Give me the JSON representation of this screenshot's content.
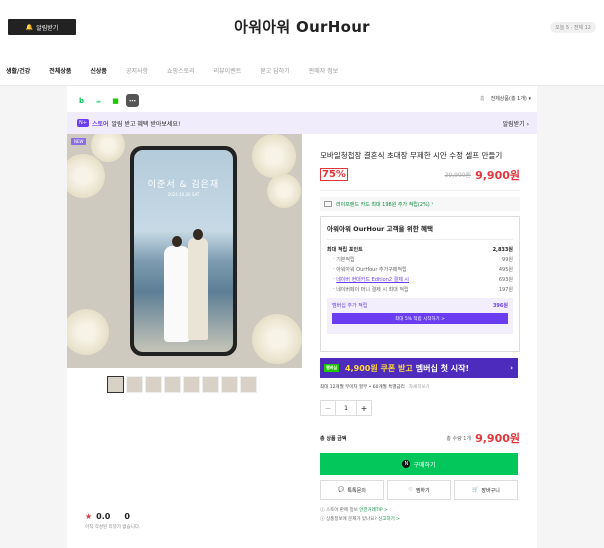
{
  "header": {
    "alarm_button": "알림받기",
    "store_name": "아워아워 OurHour",
    "visits": "오늘 5 · 전체 12"
  },
  "nav": [
    "생활/건강",
    "전체상품",
    "신상품",
    "공지사항",
    "쇼핑스토리",
    "리뷰이벤트",
    "묻고 답하기",
    "판매자 정보"
  ],
  "breadcrumb": {
    "home": "홈",
    "current": "전체상품(총 1개)"
  },
  "banner": {
    "badge": "N+",
    "brand": "스토어",
    "text": "알림 받고 혜택 받아보세요!",
    "button": "알림받기"
  },
  "product": {
    "new_badge": "NEW",
    "screen_names": "이준서 & 김은재",
    "screen_date": "2024.10.26 SAT",
    "name": "모바일청첩장 결혼식 초대장 무제한 시안 수정 셀프 만들기",
    "discount": "75%",
    "original_price": "39,900원",
    "price": "9,900원",
    "card_benefit": "라이프랜드 카드 최대 198원 추가 적립(2%)",
    "benefits": {
      "title": "아워아워 OurHour 고객을 위한 혜택",
      "max_label": "최대 적립 포인트",
      "max_value": "2,833원",
      "rows": [
        {
          "label": "기본적립",
          "value": "99원"
        },
        {
          "label": "아워아워 OurHour 추가구매적립",
          "value": "495원"
        },
        {
          "label": "네이버 현대카드 Edition2 결제 시",
          "value": "693원"
        },
        {
          "label": "네이버페이 머니 결제 시 최대 적립",
          "value": "197원"
        }
      ],
      "membership_label": "멤버십 추가 적립",
      "membership_value": "396원",
      "membership_button": "최대 5% 적립 시작하기 >"
    },
    "coupon": {
      "badge": "멤버십",
      "highlight": "4,900원 쿠폰 받고",
      "text": "멤버십 첫 시작!"
    },
    "installment": "최대 12개월 무이자 할부 • 60개월 특별금리",
    "installment_link": "자세히보기",
    "quantity": "1",
    "total_label": "총 상품 금액",
    "total_qty": "총 수량 1개",
    "total_price": "9,900원",
    "buy_button": "구매하기",
    "talk_button": "톡톡문의",
    "wish_button": "찜하기",
    "cart_button": "장바구니",
    "note1": "스토어 판매 정보",
    "note1_link": "안전거래TIP >",
    "note2": "상품정보에 문제가 있나요?",
    "note2_link": "신고하기 >"
  },
  "review": {
    "score": "0.0",
    "count": "0",
    "note": "아직 작성된 리뷰가 없습니다."
  },
  "colors": {
    "accent": "#6a3df0",
    "price": "#e0353b",
    "buy": "#03c75a"
  }
}
